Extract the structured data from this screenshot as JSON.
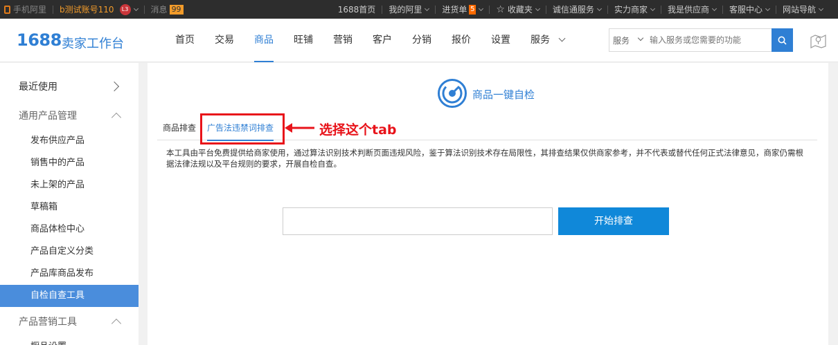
{
  "topbar": {
    "mobile_label": "手机阿里",
    "account_name": "b测试账号110",
    "level_badge": "L3",
    "messages_label": "消息",
    "messages_count": "99",
    "links": [
      {
        "label": "1688首页",
        "dropdown": false
      },
      {
        "label": "我的阿里",
        "dropdown": true
      },
      {
        "label": "进货单",
        "dropdown": true,
        "count": "5"
      },
      {
        "label": "收藏夹",
        "dropdown": true,
        "icon": "star-icon"
      },
      {
        "label": "诚信通服务",
        "dropdown": true
      },
      {
        "label": "实力商家",
        "dropdown": true
      },
      {
        "label": "我是供应商",
        "dropdown": true
      },
      {
        "label": "客服中心",
        "dropdown": true
      },
      {
        "label": "网站导航",
        "dropdown": true
      }
    ]
  },
  "header": {
    "logo": "1688",
    "logo_sub": "卖家工作台",
    "nav": [
      {
        "label": "首页",
        "active": false
      },
      {
        "label": "交易",
        "active": false
      },
      {
        "label": "商品",
        "active": true
      },
      {
        "label": "旺铺",
        "active": false
      },
      {
        "label": "营销",
        "active": false
      },
      {
        "label": "客户",
        "active": false
      },
      {
        "label": "分销",
        "active": false
      },
      {
        "label": "报价",
        "active": false
      },
      {
        "label": "设置",
        "active": false
      },
      {
        "label": "服务",
        "active": false
      }
    ],
    "search": {
      "category": "服务",
      "placeholder": "输入服务或您需要的功能"
    },
    "accent_color": "#2f7fd4"
  },
  "sidebar": {
    "recent": "最近使用",
    "group1": "通用产品管理",
    "items": [
      {
        "label": "发布供应产品",
        "active": false
      },
      {
        "label": "销售中的产品",
        "active": false
      },
      {
        "label": "未上架的产品",
        "active": false
      },
      {
        "label": "草稿箱",
        "active": false
      },
      {
        "label": "商品体检中心",
        "active": false
      },
      {
        "label": "产品自定义分类",
        "active": false
      },
      {
        "label": "产品库商品发布",
        "active": false
      },
      {
        "label": "自检自查工具",
        "active": true
      }
    ],
    "group2": "产品营销工具",
    "next_item": "橱品设置"
  },
  "main": {
    "tool_title": "商品一键自检",
    "tabs": [
      {
        "label": "商品排查",
        "active": false
      },
      {
        "label": "广告法违禁词排查",
        "active": true
      }
    ],
    "annotation": "选择这个tab",
    "description": "本工具由平台免费提供给商家使用，通过算法识别技术判断页面违规风险，鉴于算法识别技术存在局限性，其排查结果仅供商家参考，并不代表或替代任何正式法律意见，商家仍需根据法律法规以及平台规则的要求，开展自检自查。",
    "input_value": "",
    "start_button": "开始排查"
  }
}
